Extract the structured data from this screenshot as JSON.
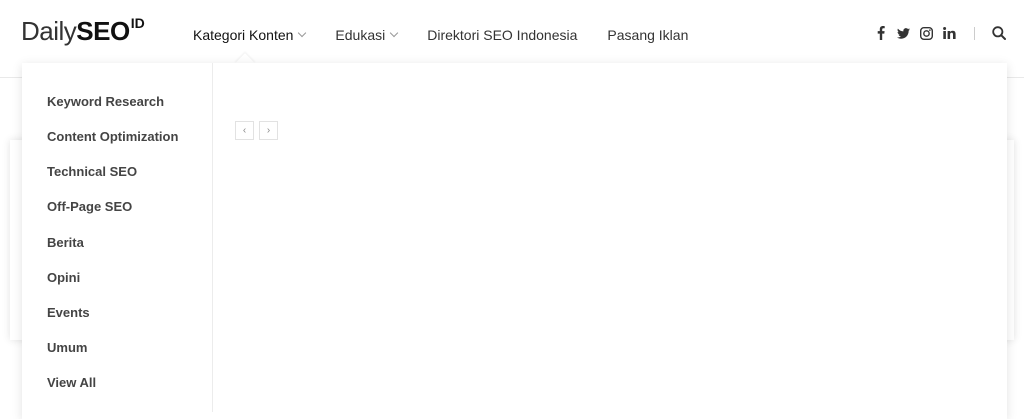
{
  "logo": {
    "part1": "Daily",
    "part2": "SEO",
    "sup": "ID"
  },
  "nav": {
    "items": [
      {
        "label": "Kategori Konten",
        "dropdown": true
      },
      {
        "label": "Edukasi",
        "dropdown": true
      },
      {
        "label": "Direktori SEO Indonesia",
        "dropdown": false
      },
      {
        "label": "Pasang Iklan",
        "dropdown": false
      }
    ]
  },
  "social": [
    "facebook-icon",
    "twitter-icon",
    "instagram-icon",
    "linkedin-icon"
  ],
  "mega": {
    "links": [
      "Keyword Research",
      "Content Optimization",
      "Technical SEO",
      "Off-Page SEO",
      "Berita",
      "Opini",
      "Events",
      "Umum",
      "View All"
    ],
    "pager": {
      "prev": "‹",
      "next": "›"
    }
  }
}
